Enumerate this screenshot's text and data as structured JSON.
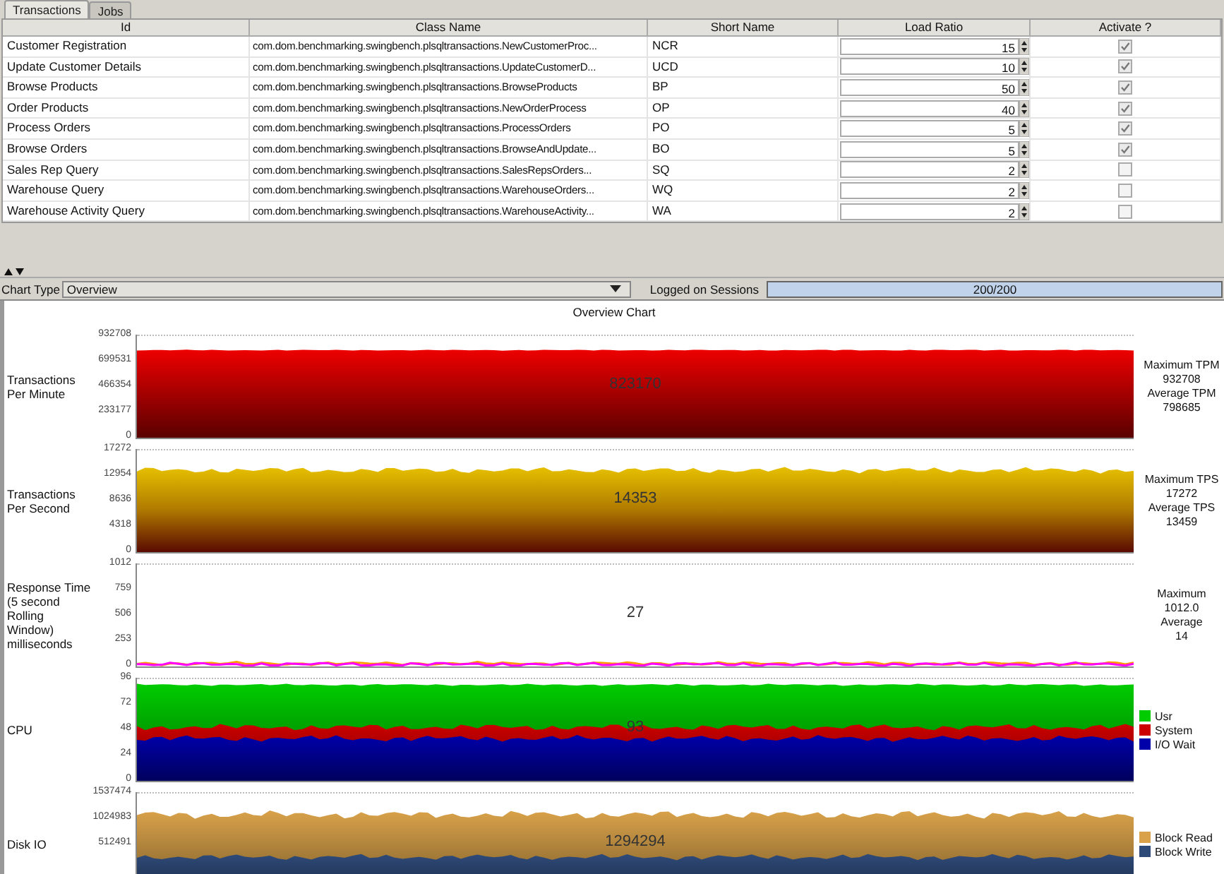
{
  "tabs": [
    {
      "label": "Transactions",
      "selected": true
    },
    {
      "label": "Jobs",
      "selected": false
    }
  ],
  "table": {
    "columns": [
      "Id",
      "Class Name",
      "Short Name",
      "Load Ratio",
      "Activate ?"
    ],
    "rows": [
      {
        "id": "Customer Registration",
        "class_name": "com.dom.benchmarking.swingbench.plsqltransactions.NewCustomerProc...",
        "short_name": "NCR",
        "load_ratio": "15",
        "activate": true
      },
      {
        "id": "Update Customer Details",
        "class_name": "com.dom.benchmarking.swingbench.plsqltransactions.UpdateCustomerD...",
        "short_name": "UCD",
        "load_ratio": "10",
        "activate": true
      },
      {
        "id": "Browse Products",
        "class_name": "com.dom.benchmarking.swingbench.plsqltransactions.BrowseProducts",
        "short_name": "BP",
        "load_ratio": "50",
        "activate": true
      },
      {
        "id": "Order Products",
        "class_name": "com.dom.benchmarking.swingbench.plsqltransactions.NewOrderProcess",
        "short_name": "OP",
        "load_ratio": "40",
        "activate": true
      },
      {
        "id": "Process Orders",
        "class_name": "com.dom.benchmarking.swingbench.plsqltransactions.ProcessOrders",
        "short_name": "PO",
        "load_ratio": "5",
        "activate": true
      },
      {
        "id": "Browse Orders",
        "class_name": "com.dom.benchmarking.swingbench.plsqltransactions.BrowseAndUpdate...",
        "short_name": "BO",
        "load_ratio": "5",
        "activate": true
      },
      {
        "id": "Sales Rep Query",
        "class_name": "com.dom.benchmarking.swingbench.plsqltransactions.SalesRepsOrders...",
        "short_name": "SQ",
        "load_ratio": "2",
        "activate": false
      },
      {
        "id": "Warehouse Query",
        "class_name": "com.dom.benchmarking.swingbench.plsqltransactions.WarehouseOrders...",
        "short_name": "WQ",
        "load_ratio": "2",
        "activate": false
      },
      {
        "id": "Warehouse Activity Query",
        "class_name": "com.dom.benchmarking.swingbench.plsqltransactions.WarehouseActivity...",
        "short_name": "WA",
        "load_ratio": "2",
        "activate": false
      }
    ]
  },
  "chart_type": {
    "label": "Chart Type",
    "value": "Overview"
  },
  "sessions": {
    "label": "Logged on Sessions",
    "value": "200/200",
    "level": 1
  },
  "chart": {
    "title": "Overview Chart",
    "panels": [
      {
        "kind": "tpm",
        "label": "Transactions Per Minute",
        "yticks": [
          "932708",
          "699531",
          "466354",
          "233177",
          "0"
        ],
        "current": "823170",
        "stats": [
          "Maximum TPM",
          "932708",
          "Average TPM",
          "798685"
        ]
      },
      {
        "kind": "tps",
        "label": "Transactions Per Second",
        "yticks": [
          "17272",
          "12954",
          "8636",
          "4318",
          "0"
        ],
        "current": "14353",
        "stats": [
          "Maximum TPS",
          "17272",
          "Average TPS",
          "13459"
        ]
      },
      {
        "kind": "response",
        "label": "Response Time (5 second Rolling Window) milliseconds",
        "yticks": [
          "1012",
          "759",
          "506",
          "253",
          "0"
        ],
        "current": "27",
        "stats": [
          "Maximum",
          "1012.0",
          "Average",
          "14"
        ]
      },
      {
        "kind": "cpu",
        "label": "CPU",
        "yticks": [
          "96",
          "72",
          "48",
          "24",
          "0"
        ],
        "current": "93",
        "legend": [
          {
            "name": "Usr",
            "color": "#00cc00"
          },
          {
            "name": "System",
            "color": "#cc0000"
          },
          {
            "name": "I/O Wait",
            "color": "#0000aa"
          }
        ]
      },
      {
        "kind": "disk",
        "label": "Disk IO",
        "yticks": [
          "1537474",
          "1024983",
          "512491"
        ],
        "current": "1294294",
        "legend": [
          {
            "name": "Block Read",
            "color": "#d9a24a"
          },
          {
            "name": "Block Write",
            "color": "#2e4a78"
          }
        ]
      }
    ]
  }
}
